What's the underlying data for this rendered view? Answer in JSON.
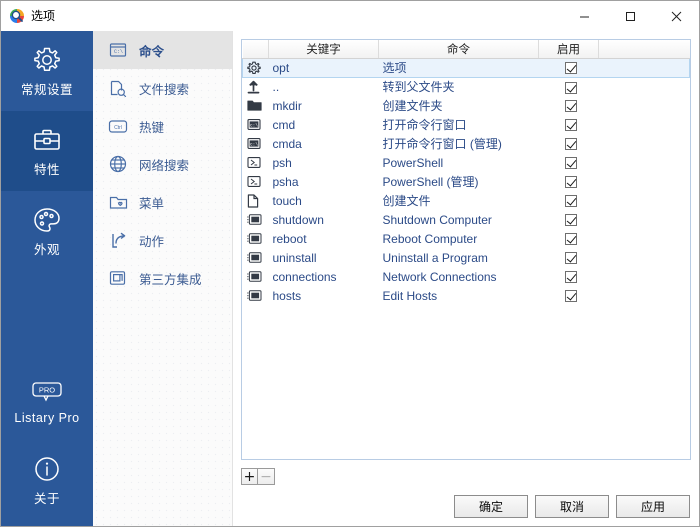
{
  "window": {
    "title": "选项",
    "icon": "listary-logo-icon",
    "controls": {
      "minimize": "minimize-icon",
      "maximize": "maximize-icon",
      "close": "close-icon"
    }
  },
  "sidebar": {
    "items": [
      {
        "label": "常规设置",
        "icon": "gear-icon",
        "selected": false
      },
      {
        "label": "特性",
        "icon": "toolbox-icon",
        "selected": true
      },
      {
        "label": "外观",
        "icon": "palette-icon",
        "selected": false
      }
    ],
    "bottom": [
      {
        "label": "Listary Pro",
        "icon": "pro-badge-icon",
        "selected": false
      },
      {
        "label": "关于",
        "icon": "info-icon",
        "selected": false
      }
    ]
  },
  "nav": {
    "items": [
      {
        "label": "命令",
        "icon": "console-window-icon",
        "selected": true
      },
      {
        "label": "文件搜索",
        "icon": "file-search-icon",
        "selected": false
      },
      {
        "label": "热键",
        "icon": "ctrl-key-icon",
        "selected": false
      },
      {
        "label": "网络搜索",
        "icon": "globe-icon",
        "selected": false
      },
      {
        "label": "菜单",
        "icon": "folder-heart-icon",
        "selected": false
      },
      {
        "label": "动作",
        "icon": "share-arrow-icon",
        "selected": false
      },
      {
        "label": "第三方集成",
        "icon": "windows-overlap-icon",
        "selected": false
      }
    ]
  },
  "table": {
    "columns": [
      "",
      "关键字",
      "命令",
      "启用",
      ""
    ],
    "rows": [
      {
        "icon": "gear-icon",
        "keyword": "opt",
        "command": "选项",
        "enabled": true,
        "selected": true
      },
      {
        "icon": "arrow-up-icon",
        "keyword": "..",
        "command": "转到父文件夹",
        "enabled": true,
        "selected": false
      },
      {
        "icon": "folder-icon",
        "keyword": "mkdir",
        "command": "创建文件夹",
        "enabled": true,
        "selected": false
      },
      {
        "icon": "cmd-icon",
        "keyword": "cmd",
        "command": "打开命令行窗口",
        "enabled": true,
        "selected": false
      },
      {
        "icon": "cmd-icon",
        "keyword": "cmda",
        "command": "打开命令行窗口 (管理)",
        "enabled": true,
        "selected": false
      },
      {
        "icon": "powershell-icon",
        "keyword": "psh",
        "command": "PowerShell",
        "enabled": true,
        "selected": false
      },
      {
        "icon": "powershell-icon",
        "keyword": "psha",
        "command": "PowerShell (管理)",
        "enabled": true,
        "selected": false
      },
      {
        "icon": "file-icon",
        "keyword": "touch",
        "command": "创建文件",
        "enabled": true,
        "selected": false
      },
      {
        "icon": "app-window-icon",
        "keyword": "shutdown",
        "command": "Shutdown Computer",
        "enabled": true,
        "selected": false
      },
      {
        "icon": "app-window-icon",
        "keyword": "reboot",
        "command": "Reboot Computer",
        "enabled": true,
        "selected": false
      },
      {
        "icon": "app-window-icon",
        "keyword": "uninstall",
        "command": "Uninstall a Program",
        "enabled": true,
        "selected": false
      },
      {
        "icon": "app-window-icon",
        "keyword": "connections",
        "command": "Network Connections",
        "enabled": true,
        "selected": false
      },
      {
        "icon": "app-window-icon",
        "keyword": "hosts",
        "command": "Edit Hosts",
        "enabled": true,
        "selected": false
      }
    ]
  },
  "toolbar": {
    "add_label": "+",
    "remove_label": "−"
  },
  "footer": {
    "ok_label": "确定",
    "cancel_label": "取消",
    "apply_label": "应用"
  },
  "colors": {
    "sidebar": "#2b5899",
    "sidebar_selected": "#1f4d8a",
    "accent_text": "#2b4a87",
    "table_border": "#b8cce4",
    "row_selected": "#eaf3fc"
  }
}
